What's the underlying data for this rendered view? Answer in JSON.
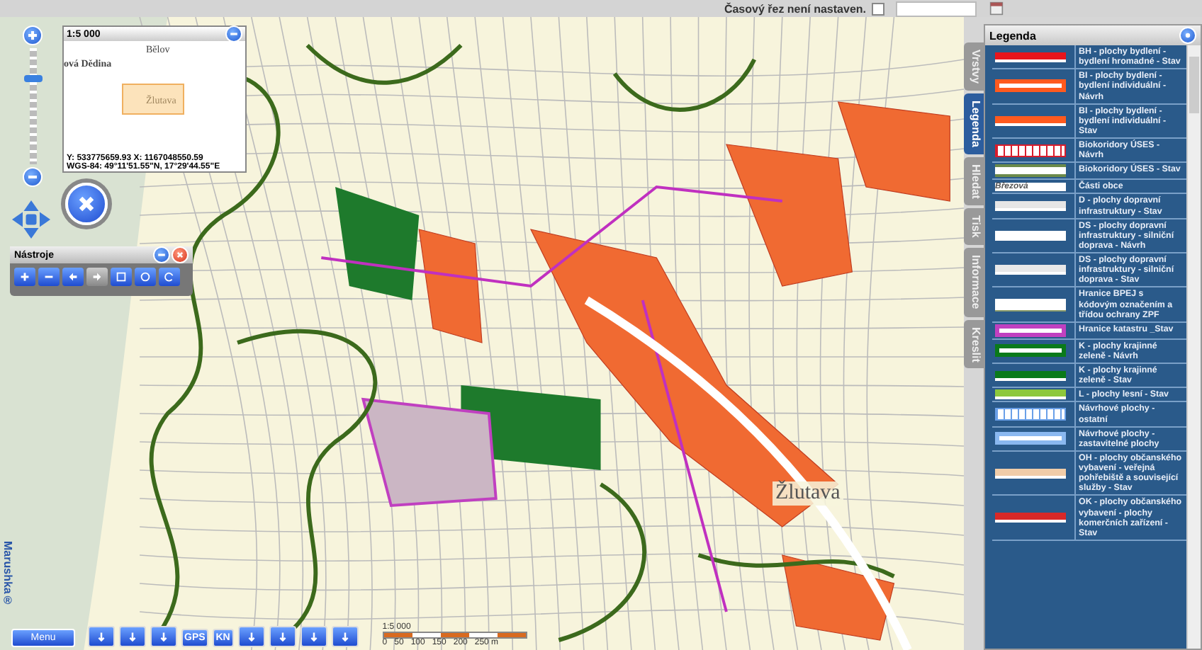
{
  "top_bar": {
    "time_slice_label": "Časový řez není nastaven.",
    "time_slice_checked": false
  },
  "map": {
    "place_label": "Žlutava"
  },
  "overview": {
    "scale": "1:5 000",
    "places": [
      {
        "name": "Bělov"
      },
      {
        "name": "ová Dědina"
      },
      {
        "name": "Žlutava"
      }
    ],
    "coords": "Y: 533775659.93 X: 1167048550.59",
    "wgs": "WGS-84: 49°11'51.55\"N, 17°29'44.55\"E"
  },
  "zoom_slider": {
    "level": 0.75
  },
  "tools": {
    "title": "Nástroje"
  },
  "brand": "Marushka®",
  "bottom_toolbar": {
    "menu": "Menu",
    "buttons": [
      {
        "kind": "icon"
      },
      {
        "kind": "icon"
      },
      {
        "kind": "icon"
      },
      {
        "kind": "text",
        "label": "GPS"
      },
      {
        "kind": "text",
        "label": "KN"
      },
      {
        "kind": "icon"
      },
      {
        "kind": "icon"
      },
      {
        "kind": "icon"
      },
      {
        "kind": "icon"
      }
    ]
  },
  "scale_bar": {
    "title": "1:5 000",
    "ticks": [
      "0",
      "50",
      "100",
      "150",
      "200",
      "250 m"
    ]
  },
  "side_tabs": [
    {
      "label": "Vrstvy",
      "selected": false
    },
    {
      "label": "Legenda",
      "selected": true
    },
    {
      "label": "Hledat",
      "selected": false
    },
    {
      "label": "Tisk",
      "selected": false
    },
    {
      "label": "Informace",
      "selected": false
    },
    {
      "label": "Kreslit",
      "selected": false
    }
  ],
  "legend": {
    "title": "Legenda",
    "items": [
      {
        "kind": "fill",
        "color": "#e8141c",
        "label": "BH - plochy bydlení - bydlení hromadné - Stav"
      },
      {
        "kind": "outline",
        "color": "#ff5a1e",
        "label": "BI - plochy bydlení - bydlení individuální - Návrh"
      },
      {
        "kind": "fill",
        "color": "#ff5a1e",
        "label": "BI - plochy bydlení - bydlení individuální - Stav"
      },
      {
        "kind": "hatch",
        "color": "#d81c2c",
        "label": "Biokoridory ÚSES - Návrh"
      },
      {
        "kind": "lines",
        "color": "#6b8a4a",
        "label": "Biokoridory ÚSES - Stav"
      },
      {
        "kind": "sample",
        "sample": "Březová",
        "label": "Části obce"
      },
      {
        "kind": "fill",
        "color": "#e6e6e6",
        "label": "D - plochy dopravní infrastruktury - Stav"
      },
      {
        "kind": "fill",
        "color": "#ffffff",
        "label": "DS - plochy dopravní infrastruktury - silniční doprava - Návrh"
      },
      {
        "kind": "fill",
        "color": "#e8e8e8",
        "label": "DS - plochy dopravní infrastruktury - silniční doprava - Stav"
      },
      {
        "kind": "underline",
        "color": "#8a9a6a",
        "label": "Hranice BPEJ s kódovým označením a třídou ochrany ZPF"
      },
      {
        "kind": "outline",
        "color": "#c040c0",
        "label": "Hranice katastru _Stav"
      },
      {
        "kind": "outline",
        "color": "#0a7a1a",
        "label": "K - plochy krajinné zeleně - Návrh"
      },
      {
        "kind": "fill",
        "color": "#0a7a1a",
        "label": "K - plochy krajinné zeleně - Stav"
      },
      {
        "kind": "fill",
        "color": "#8cc83c",
        "label": "L - plochy lesní - Stav"
      },
      {
        "kind": "hatch",
        "color": "#6aa0e8",
        "label": "Návrhové plochy - ostatní"
      },
      {
        "kind": "outline",
        "color": "#8ab8f0",
        "label": "Návrhové plochy - zastavitelné plochy"
      },
      {
        "kind": "fill",
        "color": "#f0cca8",
        "label": "OH - plochy občanského vybavení - veřejná pohřebiště a související služby - Stav"
      },
      {
        "kind": "fill",
        "color": "#d82828",
        "label": "OK - plochy občanského vybavení - plochy komerčních zařízení - Stav"
      }
    ]
  }
}
